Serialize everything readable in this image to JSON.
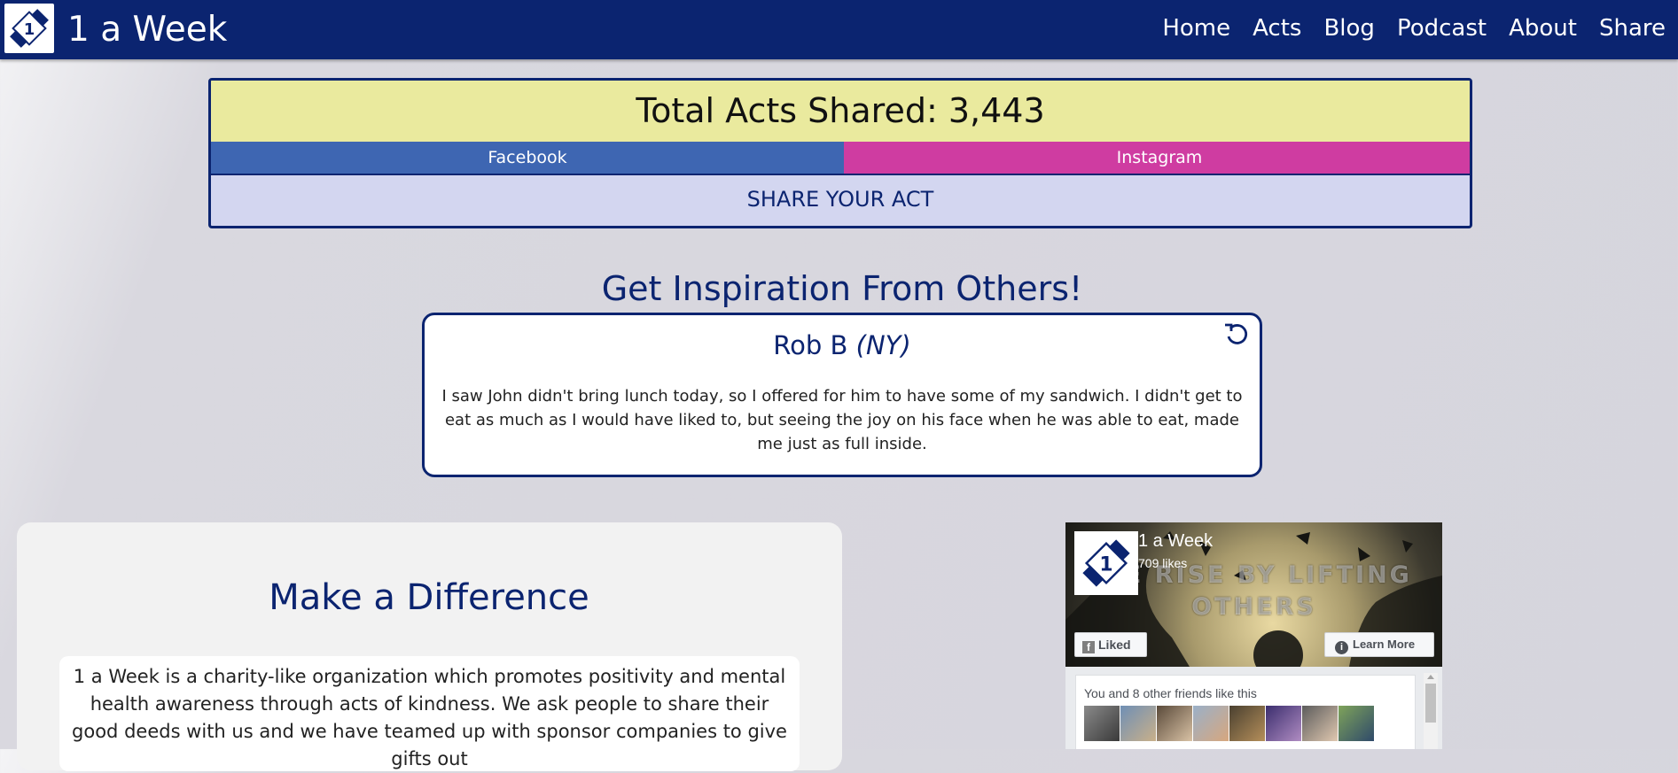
{
  "navbar": {
    "brand_title": "1 a Week",
    "links": [
      "Home",
      "Acts",
      "Blog",
      "Podcast",
      "About",
      "Share"
    ]
  },
  "counter": {
    "total_text": "Total Acts Shared: 3,443",
    "facebook_label": "Facebook",
    "instagram_label": "Instagram",
    "share_label": "SHARE YOUR ACT"
  },
  "inspiration": {
    "heading": "Get Inspiration From Others!",
    "author_name": "Rob B",
    "author_location": "(NY)",
    "act_text": "I saw John didn't bring lunch today, so I offered for him to have some of my sandwich. I didn't get to eat as much as I would have liked to, but seeing the joy on his face when he was able to eat, made me just as full inside."
  },
  "mission": {
    "heading": "Make a Difference",
    "text": "1 a Week is a charity-like organization which promotes positivity and mental health awareness through acts of kindness. We ask people to share their good deeds with us and we have teamed up with sponsor companies to give gifts out"
  },
  "facebook_widget": {
    "page_name": "1 a Week",
    "likes": "709 likes",
    "cover_text": "WE RISE BY LIFTING OTHERS",
    "liked_label": "Liked",
    "learn_more_label": "Learn More",
    "friends_text": "You and 8 other friends like this",
    "friend_count_shown": 9
  },
  "colors": {
    "brand_navy": "#0b2470",
    "facebook_blue": "#3e66b2",
    "instagram_pink": "#cf3ca1",
    "counter_yellow": "#eaea9e",
    "share_lavender": "#d3d6f0"
  },
  "icons": {
    "logo": "1-a-week-logo",
    "refresh": "refresh-icon",
    "info": "info-icon",
    "facebook_f": "facebook-f-icon"
  }
}
